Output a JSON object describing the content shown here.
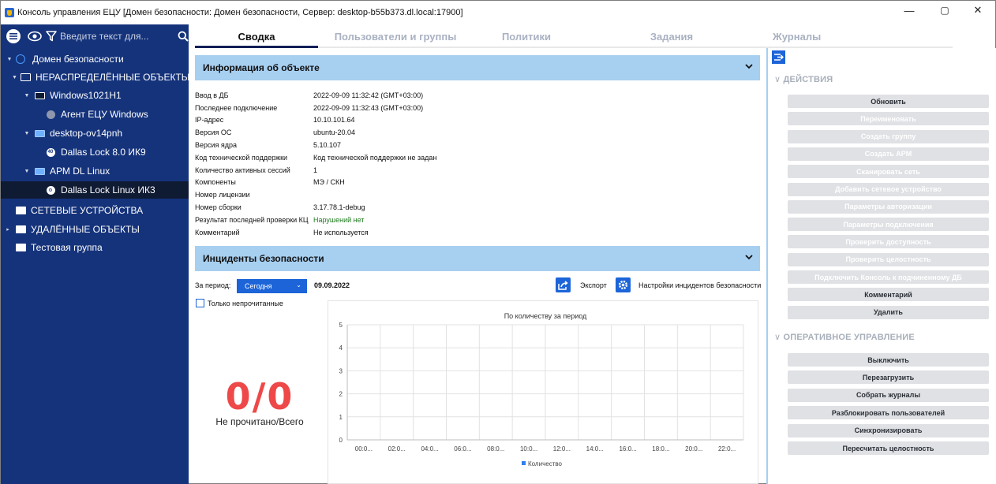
{
  "window": {
    "title": "Консоль управления ЕЦУ [Домен безопасности: Домен безопасности, Сервер: desktop-b55b373.dl.local:17900]",
    "minimize": "—",
    "maximize": "▢",
    "close": "✕"
  },
  "toolbar": {
    "search_placeholder": "Введите текст для..."
  },
  "sidebar": {
    "items": [
      {
        "label": "Домен безопасности",
        "icon": "globe-icon"
      },
      {
        "label": "НЕРАСПРЕДЕЛЁННЫЕ ОБЪЕКТЫ",
        "icon": "folder-icon"
      },
      {
        "label": "Windows1021H1",
        "icon": "monitor-icon"
      },
      {
        "label": "Агент ЕЦУ Windows",
        "icon": "agent-icon"
      },
      {
        "label": "desktop-ov14pnh",
        "icon": "monitor-icon"
      },
      {
        "label": "Dallas Lock 8.0 ИК9",
        "icon": "dallas-lock-icon"
      },
      {
        "label": "АРМ DL Linux",
        "icon": "monitor-icon"
      },
      {
        "label": "Dallas Lock Linux ИК3",
        "icon": "dallas-lock-icon"
      },
      {
        "label": "СЕТЕВЫЕ УСТРОЙСТВА",
        "icon": "folder-icon"
      },
      {
        "label": "УДАЛЁННЫЕ ОБЪЕКТЫ",
        "icon": "folder-icon"
      },
      {
        "label": "Тестовая группа",
        "icon": "folder-icon"
      }
    ]
  },
  "tabs": [
    {
      "label": "Сводка",
      "active": true
    },
    {
      "label": "Пользователи и группы",
      "active": false
    },
    {
      "label": "Политики",
      "active": false
    },
    {
      "label": "Задания",
      "active": false
    },
    {
      "label": "Журналы",
      "active": false
    }
  ],
  "info": {
    "header": "Информация об объекте",
    "rows": [
      {
        "key": "Ввод в ДБ",
        "value": "2022-09-09 11:32:42 (GMT+03:00)"
      },
      {
        "key": "Последнее подключение",
        "value": "2022-09-09 11:32:43 (GMT+03:00)"
      },
      {
        "key": "IP-адрес",
        "value": "10.10.101.64"
      },
      {
        "key": "Версия ОС",
        "value": "ubuntu-20.04"
      },
      {
        "key": "Версия ядра",
        "value": "5.10.107"
      },
      {
        "key": "Код технической поддержки",
        "value": "Код технической поддержки не задан"
      },
      {
        "key": "Количество активных сессий",
        "value": "1"
      },
      {
        "key": "Компоненты",
        "value": "МЭ / СКН"
      },
      {
        "key": "Номер лицензии",
        "value": ""
      },
      {
        "key": "Номер сборки",
        "value": "3.17.78.1-debug"
      },
      {
        "key": "Результат последней проверки КЦ",
        "value": "Нарушений нет"
      },
      {
        "key": "Комментарий",
        "value": "Не используется"
      }
    ]
  },
  "incidents": {
    "header": "Инциденты безопасности",
    "period_label": "За период:",
    "period_value": "Сегодня",
    "date": "09.09.2022",
    "export_label": "Экспорт",
    "settings_label": "Настройки инцидентов безопасности",
    "only_unread_label": "Только непрочитанные",
    "only_unread_checked": false,
    "counter": "0/0",
    "counter_caption": "Не прочитано/Всего"
  },
  "chart_data": {
    "type": "bar",
    "title": "По количеству за период",
    "categories": [
      "00:0...",
      "02:0...",
      "04:0...",
      "06:0...",
      "08:0...",
      "10:0...",
      "12:0...",
      "14:0...",
      "16:0...",
      "18:0...",
      "20:0...",
      "22:0..."
    ],
    "series": [
      {
        "name": "Количество",
        "values": [
          0,
          0,
          0,
          0,
          0,
          0,
          0,
          0,
          0,
          0,
          0,
          0
        ],
        "color": "#2f80ed"
      }
    ],
    "ylim": [
      0,
      5
    ],
    "yticks": [
      "0",
      "1",
      "2",
      "3",
      "4",
      "5"
    ],
    "grid": true,
    "legend": "bottom"
  },
  "right_panel": {
    "actions_title": "ДЕЙСТВИЯ",
    "actions": [
      {
        "label": "Обновить",
        "enabled": true
      },
      {
        "label": "Переименовать",
        "enabled": false
      },
      {
        "label": "Создать группу",
        "enabled": false
      },
      {
        "label": "Создать АРМ",
        "enabled": false
      },
      {
        "label": "Сканировать сеть",
        "enabled": false
      },
      {
        "label": "Добавить сетевое устройство",
        "enabled": false
      },
      {
        "label": "Параметры авторизации",
        "enabled": false
      },
      {
        "label": "Параметры подключения",
        "enabled": false
      },
      {
        "label": "Проверить доступность",
        "enabled": false
      },
      {
        "label": "Проверить целостность",
        "enabled": false
      },
      {
        "label": "Подключить Консоль к подчиненному ДБ",
        "enabled": false
      },
      {
        "label": "Комментарий",
        "enabled": true
      },
      {
        "label": "Удалить",
        "enabled": true
      }
    ],
    "ops_title": "ОПЕРАТИВНОЕ УПРАВЛЕНИЕ",
    "ops": [
      {
        "label": "Выключить",
        "enabled": true
      },
      {
        "label": "Перезагрузить",
        "enabled": true
      },
      {
        "label": "Собрать журналы",
        "enabled": true
      },
      {
        "label": "Разблокировать пользователей",
        "enabled": true
      },
      {
        "label": "Синхронизировать",
        "enabled": true
      },
      {
        "label": "Пересчитать целостность",
        "enabled": true
      }
    ]
  },
  "colors": {
    "sidebar_bg": "#15337b",
    "sidebar_selected": "#0f1a33",
    "accent": "#1c64d8",
    "panel_header": "#a7cff0",
    "counter": "#ee4848",
    "ok_green": "#1e7b1e"
  }
}
